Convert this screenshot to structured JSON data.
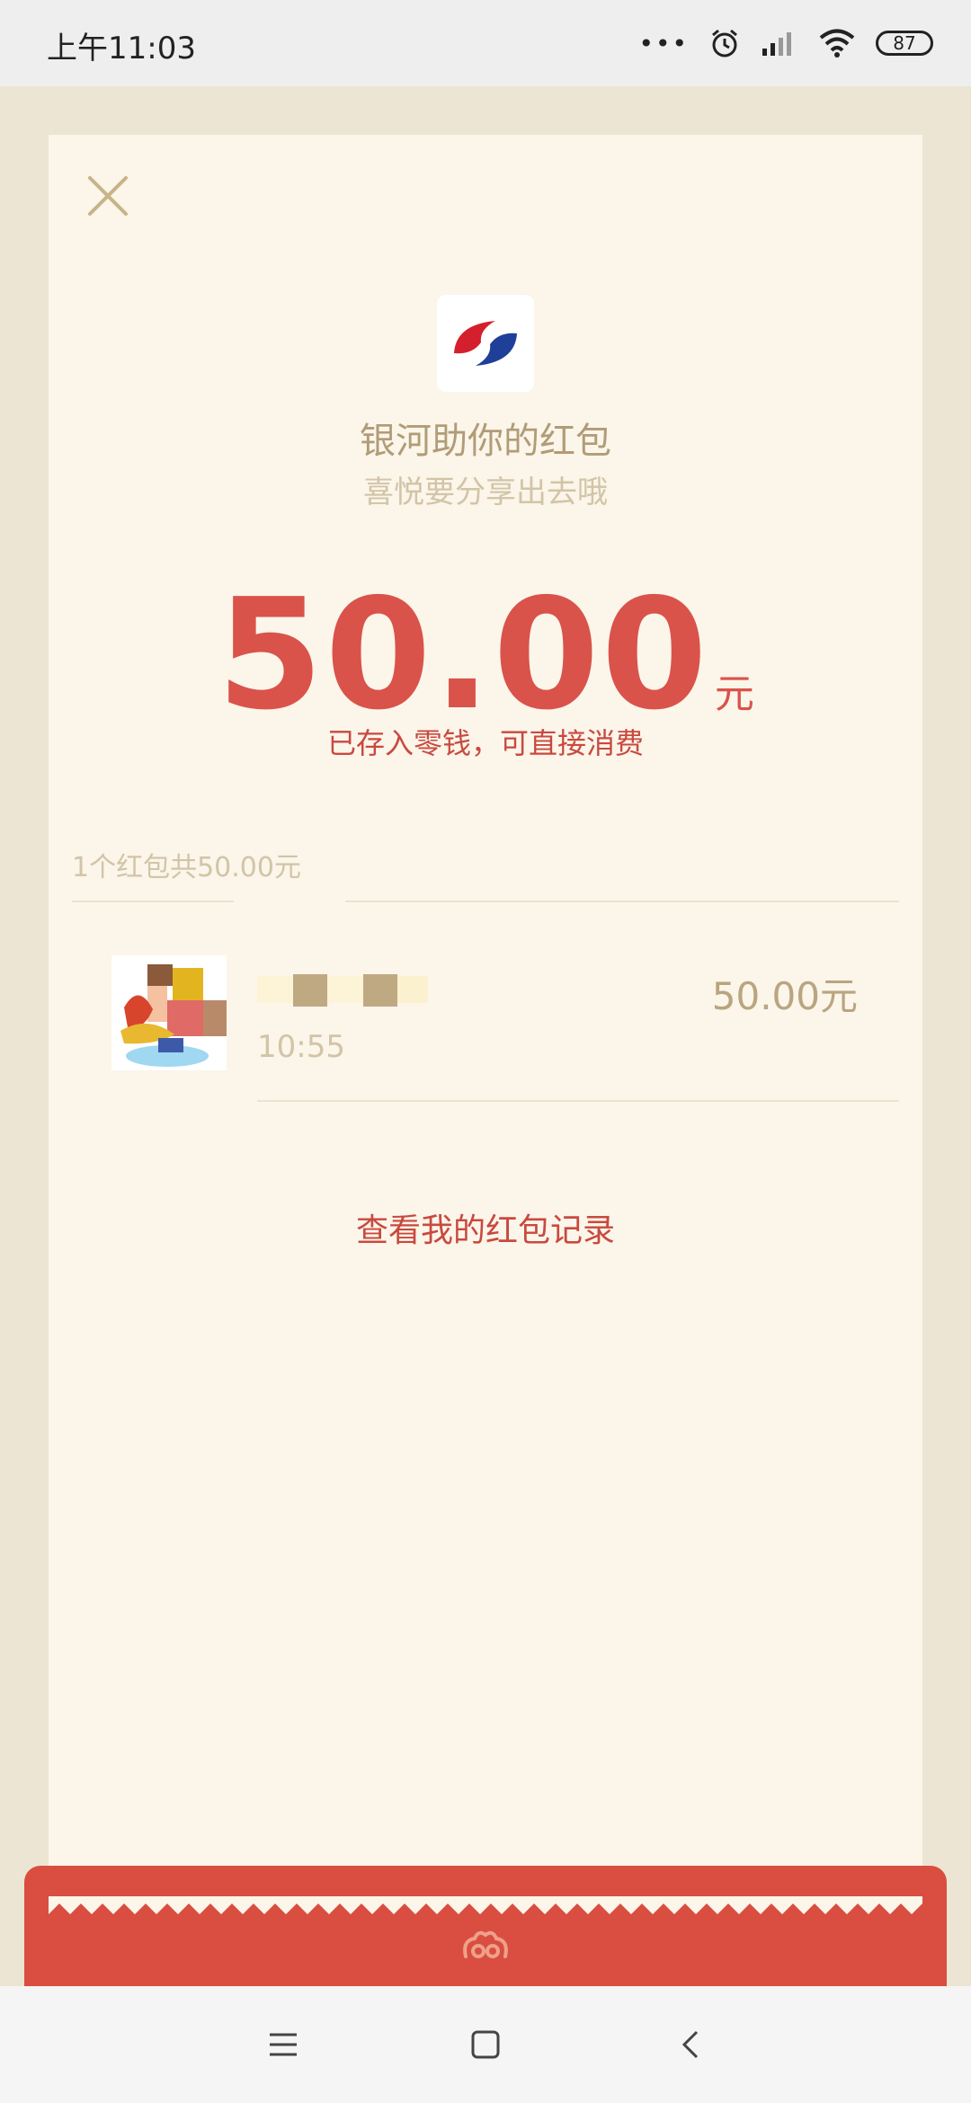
{
  "status_bar": {
    "time": "上午11:03",
    "dots": "•••",
    "battery": "87"
  },
  "icons": {
    "close": "close-icon",
    "bank_logo": "bank-logo-icon",
    "alarm": "alarm-icon",
    "signal": "signal-icon",
    "wifi": "wifi-icon",
    "battery": "battery-icon",
    "menu": "menu-icon",
    "home": "home-icon",
    "back": "back-icon"
  },
  "packet": {
    "sender_title": "银河助你的红包",
    "blessing": "喜悦要分享出去哦",
    "amount": "50.00",
    "unit": "元",
    "saved_note": "已存入零钱，可直接消费",
    "summary": "1个红包共50.00元"
  },
  "receivers": [
    {
      "time": "10:55",
      "amount": "50.00元"
    }
  ],
  "actions": {
    "view_records": "查看我的红包记录"
  },
  "colors": {
    "accent_red": "#d9534a",
    "gold_text": "#b09c76",
    "card_bg": "#fbf5ea",
    "page_bg": "#ece5d3",
    "envelope_red": "#d94e40"
  }
}
